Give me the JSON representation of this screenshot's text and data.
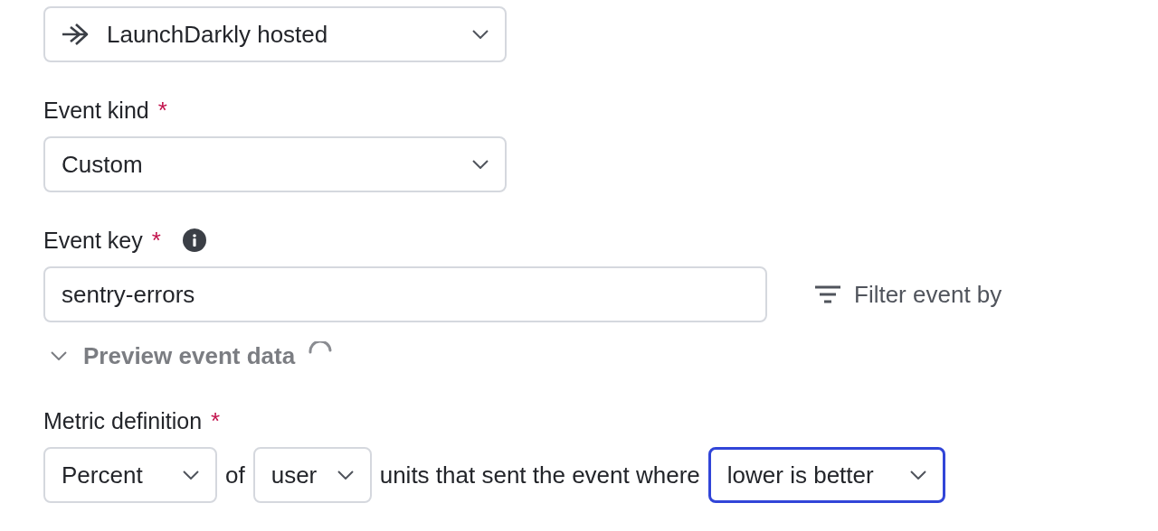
{
  "source": {
    "value": "LaunchDarkly hosted"
  },
  "event_kind": {
    "label": "Event kind",
    "required_mark": "*",
    "value": "Custom"
  },
  "event_key": {
    "label": "Event key",
    "required_mark": "*",
    "value": "sentry-errors"
  },
  "filter_button": {
    "label": "Filter event by"
  },
  "preview": {
    "label": "Preview event data",
    "expanded": false,
    "loading": true
  },
  "metric_definition": {
    "label": "Metric definition",
    "required_mark": "*",
    "parts": [
      {
        "kind": "select",
        "value": "Percent",
        "focused": false
      },
      {
        "kind": "text",
        "text": "of"
      },
      {
        "kind": "select",
        "value": "user",
        "focused": false
      },
      {
        "kind": "text",
        "text": "units that sent the event where"
      },
      {
        "kind": "select",
        "value": "lower is better",
        "focused": true
      }
    ]
  }
}
